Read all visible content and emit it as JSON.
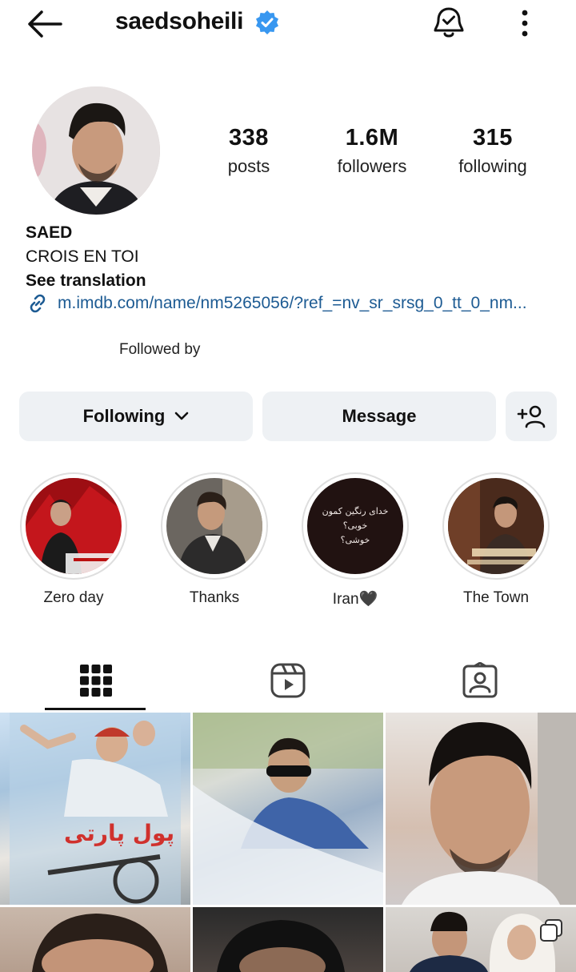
{
  "header": {
    "username": "saedsoheili",
    "verified": true
  },
  "stats": {
    "posts": {
      "value": "338",
      "label": "posts"
    },
    "followers": {
      "value": "1.6M",
      "label": "followers"
    },
    "following": {
      "value": "315",
      "label": "following"
    }
  },
  "bio": {
    "name": "SAED",
    "tagline": "CROIS EN TOI",
    "see_translation": "See translation",
    "link": "m.imdb.com/name/nm5265056/?ref_=nv_sr_srsg_0_tt_0_nm...",
    "followed_by": "Followed by"
  },
  "actions": {
    "following_label": "Following",
    "message_label": "Message"
  },
  "highlights": [
    {
      "label": "Zero day"
    },
    {
      "label": "Thanks"
    },
    {
      "label": "Iran🖤",
      "text_lines": [
        "خدای رنگین کمون",
        "خوبی؟",
        "خوشی؟"
      ]
    },
    {
      "label": "The Town"
    }
  ],
  "tabs": [
    {
      "icon": "grid-icon",
      "active": true
    },
    {
      "icon": "reels-icon",
      "active": false
    },
    {
      "icon": "tagged-icon",
      "active": false
    }
  ],
  "colors": {
    "accent_link": "#1d5b93",
    "verified_blue": "#3897f0",
    "button_bg": "#eef1f4"
  }
}
